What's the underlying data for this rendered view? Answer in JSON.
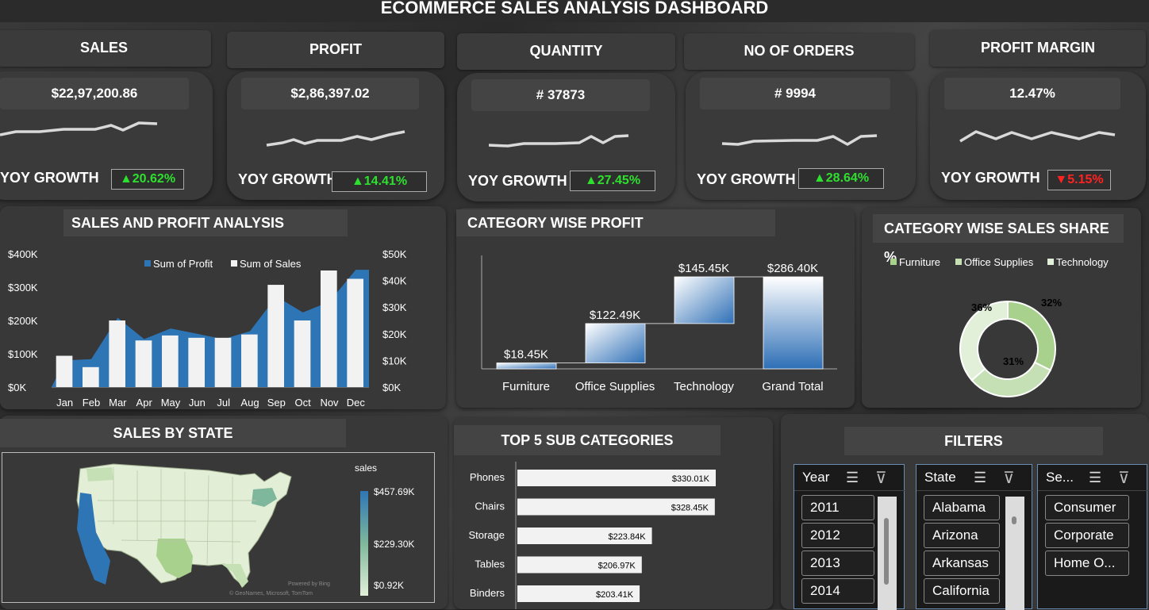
{
  "title": "ECOMMERCE SALES ANALYSIS DASHBOARD",
  "kpis": [
    {
      "label": "SALES",
      "value": "$22,97,200.86",
      "yoy_label": "YOY GROWTH",
      "yoy_arrow": "▲",
      "yoy_value": "20.62%",
      "direction": "up"
    },
    {
      "label": "PROFIT",
      "value": "$2,86,397.02",
      "yoy_label": "YOY GROWTH",
      "yoy_arrow": "▲",
      "yoy_value": "14.41%",
      "direction": "up"
    },
    {
      "label": "QUANTITY",
      "value": "# 37873",
      "yoy_label": "YOY GROWTH",
      "yoy_arrow": "▲",
      "yoy_value": "27.45%",
      "direction": "up"
    },
    {
      "label": "NO OF ORDERS",
      "value": "# 9994",
      "yoy_label": "YOY GROWTH",
      "yoy_arrow": "▲",
      "yoy_value": "28.64%",
      "direction": "up"
    },
    {
      "label": "PROFIT MARGIN",
      "value": "12.47%",
      "yoy_label": "YOY GROWTH",
      "yoy_arrow": "▼",
      "yoy_value": "5.15%",
      "direction": "down"
    }
  ],
  "colors": {
    "up": "#2ee02e",
    "down": "#ff2222",
    "profit": "#2e75b6",
    "sales": "#f2f2f2",
    "furniture": "#a9d18e",
    "office": "#c5e0b4",
    "technology": "#e2f0d9"
  },
  "sales_profit": {
    "title": "SALES AND PROFIT ANALYSIS",
    "legend_profit": "Sum of Profit",
    "legend_sales": "Sum of Sales",
    "left_ticks": [
      "$400K",
      "$300K",
      "$200K",
      "$100K",
      "$0K"
    ],
    "right_ticks": [
      "$50K",
      "$40K",
      "$30K",
      "$20K",
      "$10K",
      "$0K"
    ]
  },
  "category_profit": {
    "title": "CATEGORY WISE PROFIT"
  },
  "category_share": {
    "title": "CATEGORY WISE SALES SHARE %"
  },
  "state_map": {
    "title": "SALES BY STATE",
    "legend_title": "sales",
    "legend_max": "$457.69K",
    "legend_mid": "$229.30K",
    "legend_min": "$0.92K",
    "credit1": "Powered by Bing",
    "credit2": "© GeoNames, Microsoft, TomTom"
  },
  "top5": {
    "title": "TOP 5 SUB CATEGORIES"
  },
  "filters": {
    "title": "FILTERS",
    "year": {
      "title": "Year",
      "items": [
        "2011",
        "2012",
        "2013",
        "2014"
      ]
    },
    "state": {
      "title": "State",
      "items": [
        "Alabama",
        "Arizona",
        "Arkansas",
        "California"
      ]
    },
    "segment": {
      "title": "Se...",
      "items": [
        "Consumer",
        "Corporate",
        "Home O..."
      ]
    }
  },
  "chart_data": [
    {
      "type": "bar",
      "title": "SALES AND PROFIT ANALYSIS",
      "categories": [
        "Jan",
        "Feb",
        "Mar",
        "Apr",
        "May",
        "Jun",
        "Jul",
        "Aug",
        "Sep",
        "Oct",
        "Nov",
        "Dec"
      ],
      "series": [
        {
          "name": "Sum of Sales",
          "axis": "left",
          "values": [
            94000,
            60000,
            200000,
            140000,
            155000,
            148000,
            148000,
            158000,
            307000,
            200000,
            350000,
            325000
          ]
        },
        {
          "name": "Sum of Profit",
          "axis": "right",
          "values": [
            10000,
            10500,
            26000,
            18000,
            22000,
            20000,
            18000,
            21000,
            34000,
            28000,
            32000,
            44000
          ]
        }
      ],
      "ylim_left": [
        0,
        400000
      ],
      "ylim_right": [
        0,
        50000
      ]
    },
    {
      "type": "bar",
      "title": "CATEGORY WISE PROFIT",
      "categories": [
        "Furniture",
        "Office Supplies",
        "Technology",
        "Grand Total"
      ],
      "values": [
        18.45,
        122.49,
        145.45,
        286.4
      ],
      "labels": [
        "$18.45K",
        "$122.49K",
        "$145.45K",
        "$286.40K"
      ]
    },
    {
      "type": "pie",
      "title": "CATEGORY WISE SALES SHARE %",
      "categories": [
        "Furniture",
        "Office Supplies",
        "Technology"
      ],
      "values": [
        32,
        31,
        36
      ],
      "labels": [
        "32%",
        "31%",
        "36%"
      ]
    },
    {
      "type": "bar",
      "title": "TOP 5 SUB CATEGORIES",
      "categories": [
        "Phones",
        "Chairs",
        "Storage",
        "Tables",
        "Binders"
      ],
      "values": [
        330.01,
        328.45,
        223.84,
        206.97,
        203.41
      ],
      "labels": [
        "$330.01K",
        "$328.45K",
        "$223.84K",
        "$206.97K",
        "$203.41K"
      ]
    }
  ]
}
